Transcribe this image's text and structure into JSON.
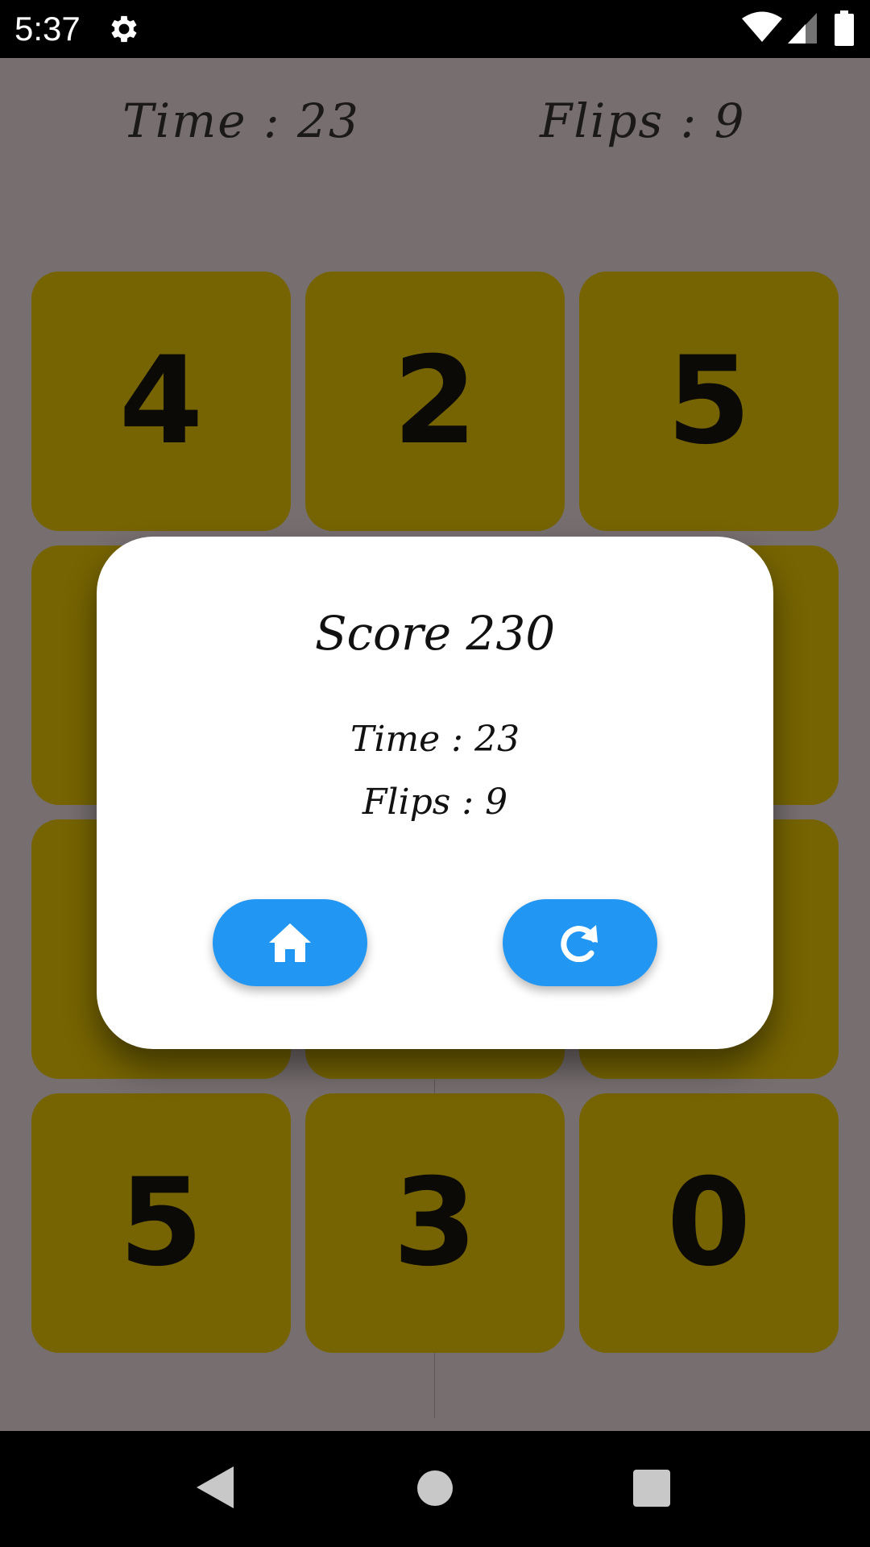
{
  "status_bar": {
    "time": "5:37",
    "icons": [
      "gear-icon",
      "wifi-icon",
      "signal-icon",
      "battery-icon"
    ]
  },
  "hud": {
    "time_text": "Time : 23",
    "flips_text": "Flips : 9"
  },
  "cards": [
    {
      "value": "4"
    },
    {
      "value": "2"
    },
    {
      "value": "5"
    },
    {
      "value": ""
    },
    {
      "value": ""
    },
    {
      "value": ""
    },
    {
      "value": ""
    },
    {
      "value": ""
    },
    {
      "value": ""
    },
    {
      "value": "5"
    },
    {
      "value": "3"
    },
    {
      "value": "0"
    }
  ],
  "dialog": {
    "title": "Score 230",
    "time_text": "Time : 23",
    "flips_text": "Flips : 9",
    "buttons": [
      {
        "icon": "home-icon"
      },
      {
        "icon": "replay-icon"
      }
    ]
  },
  "colors": {
    "background": "#766e6f",
    "card": "#766402",
    "button": "#2196f3",
    "dialog": "#ffffff"
  },
  "nav_bar": {
    "icons": [
      "back-icon",
      "home-circle-icon",
      "recents-icon"
    ]
  }
}
